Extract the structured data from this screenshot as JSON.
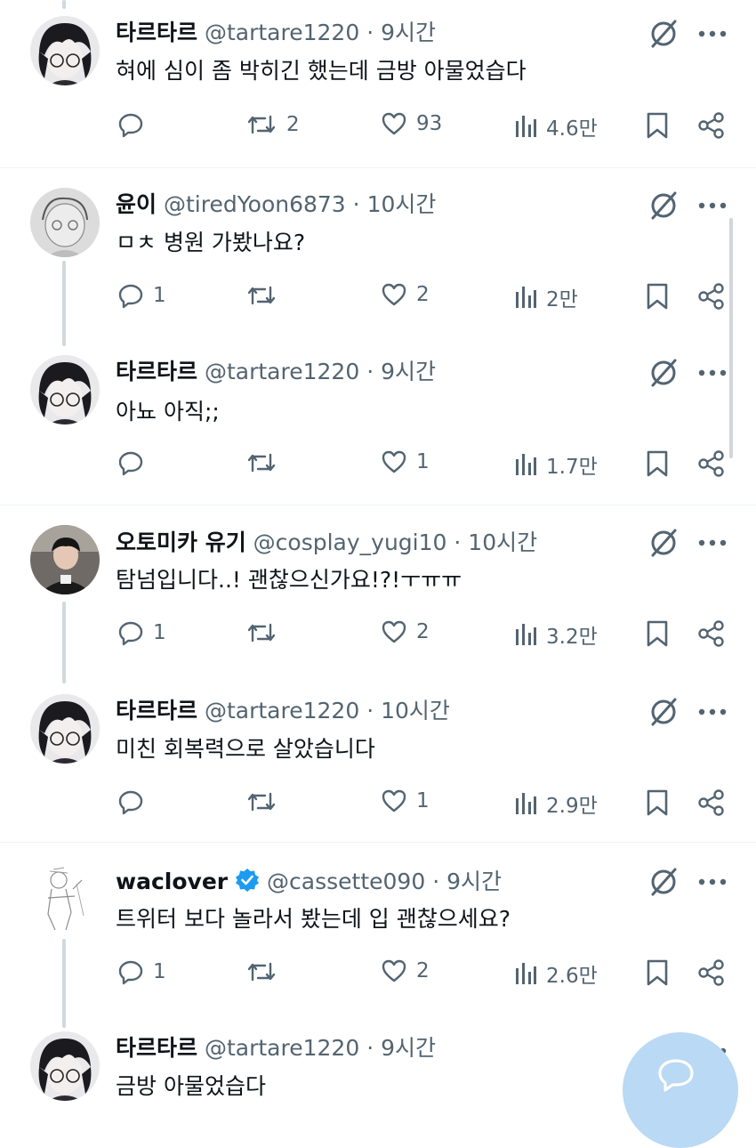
{
  "tweets": [
    {
      "name": "타르타르",
      "handle": "@tartare1220",
      "sep": "·",
      "time": "9시간",
      "text": "혀에 심이 좀 박히긴 했는데 금방 아물었습다",
      "replies": "",
      "retweets": "2",
      "likes": "93",
      "views": "4.6만",
      "verified": false,
      "avatar": "dark-hair-glasses-avatar"
    },
    {
      "name": "윤이",
      "handle": "@tiredYoon6873",
      "sep": "·",
      "time": "10시간",
      "text": "ㅁㅊ 병원 가봤나요?",
      "replies": "1",
      "retweets": "",
      "likes": "2",
      "views": "2만",
      "verified": false,
      "avatar": "sketch-avatar"
    },
    {
      "name": "타르타르",
      "handle": "@tartare1220",
      "sep": "·",
      "time": "9시간",
      "text": "아뇨 아직;;",
      "replies": "",
      "retweets": "",
      "likes": "1",
      "views": "1.7만",
      "verified": false,
      "avatar": "dark-hair-glasses-avatar"
    },
    {
      "name": "오토미카 유기",
      "handle": "@cosplay_yugi10",
      "sep": "·",
      "time": "10시간",
      "text": "탐넘입니다..! 괜찮으신가요!?!ㅜㅠㅠ",
      "replies": "1",
      "retweets": "",
      "likes": "2",
      "views": "3.2만",
      "verified": false,
      "avatar": "photo-avatar"
    },
    {
      "name": "타르타르",
      "handle": "@tartare1220",
      "sep": "·",
      "time": "10시간",
      "text": "미친 회복력으로 살았습니다",
      "replies": "",
      "retweets": "",
      "likes": "1",
      "views": "2.9만",
      "verified": false,
      "avatar": "dark-hair-glasses-avatar"
    },
    {
      "name": "waclover",
      "handle": "@cassette090",
      "sep": "·",
      "time": "9시간",
      "text": "트위터 보다 놀라서 봤는데 입 괜찮으세요?",
      "replies": "1",
      "retweets": "",
      "likes": "2",
      "views": "2.6만",
      "verified": true,
      "avatar": "line-drawing-avatar"
    },
    {
      "name": "타르타르",
      "handle": "@tartare1220",
      "sep": "·",
      "time": "9시간",
      "text": "금방 아물었습다",
      "replies": "",
      "retweets": "",
      "likes": "",
      "views": "",
      "verified": false,
      "avatar": "dark-hair-glasses-avatar"
    }
  ],
  "colors": {
    "text": "#0f1419",
    "secondary": "#536471",
    "verified": "#1d9bf0",
    "fab": "#b9d9f4",
    "divider": "#eff3f4"
  },
  "icons": [
    "reply-icon",
    "retweet-icon",
    "like-icon",
    "views-icon",
    "bookmark-icon",
    "share-icon",
    "grok-icon",
    "more-icon",
    "compose-icon"
  ]
}
